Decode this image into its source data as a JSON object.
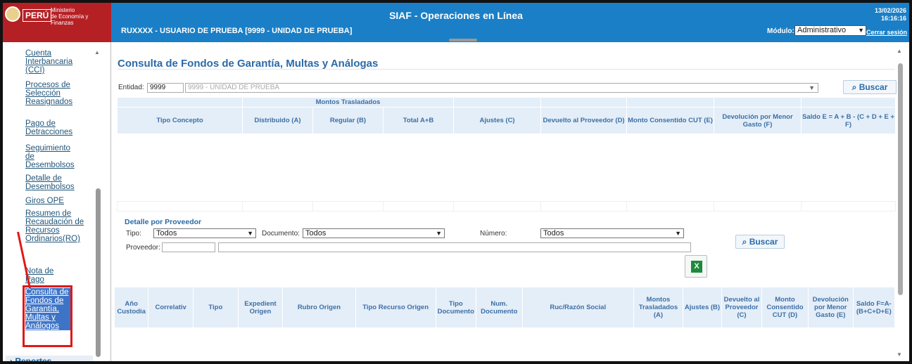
{
  "header": {
    "ministry_line1": "Ministerio",
    "ministry_line2": "de Economía y Finanzas",
    "peru": "PERÚ",
    "title": "SIAF - Operaciones en Línea",
    "date": "13/02/2026",
    "time": "16:16:16",
    "user": "RUXXXX - USUARIO DE PRUEBA [9999 - UNIDAD DE PRUEBA]",
    "module_label": "Módulo:",
    "module_value": "Administrativo",
    "logout": "Cerrar sesión"
  },
  "sidebar": {
    "items": [
      {
        "label": "Cuenta Interbancaria (CCI)"
      },
      {
        "label": "Procesos de Selección Reasignados"
      },
      {
        "label": "Pago de Detracciones"
      },
      {
        "label": "Seguimiento de Desembolsos"
      },
      {
        "label": "Detalle de Desembolsos"
      },
      {
        "label": "Giros OPE"
      },
      {
        "label": "Resumen de Recaudación de Recursos Ordinarios(RO)"
      },
      {
        "label": "Nota de Pago"
      }
    ],
    "selected": "Consulta de Fondos de Garantía, Multas y Análogos",
    "reportes": "Reportes"
  },
  "main": {
    "title": "Consulta de Fondos de Garantía, Multas y Análogas",
    "entidad_label": "Entidad:",
    "entidad_code": "9999",
    "entidad_name": "9999 - UNIDAD DE PRUEBA",
    "search_button": "Buscar",
    "table1": {
      "group_header": "Montos Trasladados",
      "columns": [
        "Tipo Concepto",
        "Distribuido (A)",
        "Regular (B)",
        "Total A+B",
        "Ajustes (C)",
        "Devuelto al Proveedor (D)",
        "Monto Consentido CUT (E)",
        "Devolución por Menor Gasto (F)",
        "Saldo E = A + B - (C + D + E + F)"
      ]
    },
    "detalle": {
      "title": "Detalle por Proveedor",
      "tipo_label": "Tipo:",
      "tipo_value": "Todos",
      "documento_label": "Documento:",
      "documento_value": "Todos",
      "numero_label": "Número:",
      "numero_value": "Todos",
      "proveedor_label": "Proveedor:",
      "search_button": "Buscar"
    },
    "table2": {
      "columns": [
        "Año Custodia",
        "Correlativ",
        "Tipo",
        "Expedient Origen",
        "Rubro Origen",
        "Tipo Recurso Origen",
        "Tipo Documento",
        "Num. Documento",
        "Ruc/Razón Social",
        "Montos Trasladados (A)",
        "Ajustes (B)",
        "Devuelto al Proveedor (C)",
        "Monto Consentido CUT (D)",
        "Devolución por Menor Gasto (E)",
        "Saldo F=A-(B+C+D+E)"
      ]
    }
  },
  "colors": {
    "header_bg": "#1a7fc6",
    "logo_red": "#b52025",
    "title_blue": "#2b6aa9",
    "highlight_red": "#e01818",
    "selected_bg": "#3d74c8"
  }
}
